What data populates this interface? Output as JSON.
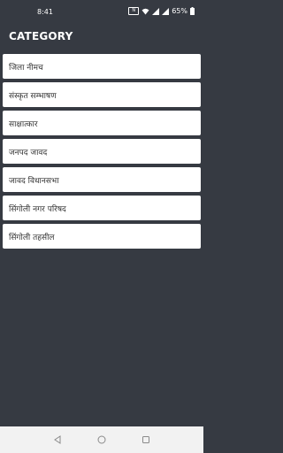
{
  "status_bar": {
    "time": "8:41",
    "battery": "65%",
    "icons": [
      "nfc-icon",
      "wifi-icon",
      "signal-icon",
      "battery-icon"
    ]
  },
  "header": {
    "title": "CATEGORY"
  },
  "categories": [
    {
      "label": "जिला नीमच"
    },
    {
      "label": "संस्कृत सम्भाषण"
    },
    {
      "label": "साक्षात्कार"
    },
    {
      "label": "जनपद जावद"
    },
    {
      "label": "जावद विधानसभा"
    },
    {
      "label": "सिंगोली नगर परिषद"
    },
    {
      "label": "सिंगोली तहसील"
    }
  ],
  "nav_bar": {
    "icons": [
      "back-icon",
      "home-icon",
      "recents-icon"
    ]
  },
  "colors": {
    "background": "#363a42",
    "card": "#ffffff",
    "nav_bar": "#f2f2f2"
  }
}
